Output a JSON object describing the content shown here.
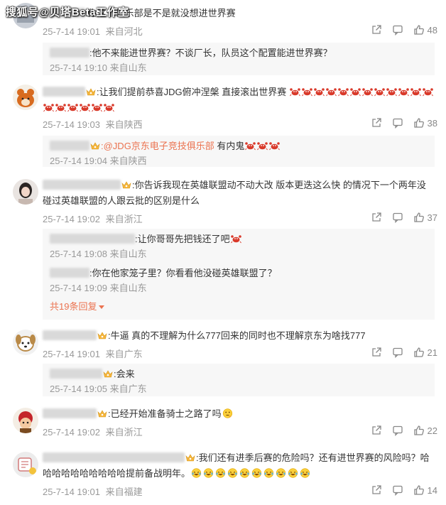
{
  "watermark": "搜狐号@贝塔Beta工作室",
  "comments": [
    {
      "text": ":你这个俱乐部是不是就没想进世界赛",
      "time": "25-7-14 19:01",
      "location": "来自河北",
      "likes": "48",
      "replies": [
        {
          "text": ":他不来能进世界赛？不谈厂长，队员这个配置能进世界赛？",
          "time": "25-7-14 19:10",
          "location": "来自山东"
        }
      ]
    },
    {
      "text": ":让我们提前恭喜JDG俯冲涅槃 直接滚出世界赛",
      "time": "25-7-14 19:03",
      "location": "来自陕西",
      "likes": "38",
      "replies": [
        {
          "at": ":@JDG京东电子竞技俱乐部",
          "text": " 有内鬼",
          "time": "25-7-14 19:04",
          "location": "来自陕西"
        }
      ]
    },
    {
      "text": ":你告诉我现在英雄联盟动不动大改 版本更迭这么快 的情况下一个两年没碰过英雄联盟的人跟云批的区别是什么",
      "time": "25-7-14 19:02",
      "location": "来自浙江",
      "likes": "37",
      "replies": [
        {
          "text": ":让你哥哥先把钱还了吧",
          "time": "25-7-14 19:08",
          "location": "来自山东"
        },
        {
          "text": ":你在他家笼子里？你看看他没碰英雄联盟了？",
          "time": "25-7-14 19:09",
          "location": "来自山东"
        }
      ],
      "more": "共19条回复"
    },
    {
      "text": ":牛逼 真的不理解为什么777回来的同时也不理解京东为啥找777",
      "time": "25-7-14 19:01",
      "location": "来自广东",
      "likes": "21",
      "replies": [
        {
          "text": ":会来",
          "time": "25-7-14 19:05",
          "location": "来自广东"
        }
      ]
    },
    {
      "text": ":已经开始准备骑士之路了吗",
      "time": "25-7-14 19:02",
      "location": "来自浙江",
      "likes": "22",
      "replies": []
    },
    {
      "text": ":我们还有进季后赛的危险吗？还有进世界赛的风险吗？哈哈哈哈哈哈哈哈哈哈提前备战明年。",
      "time": "25-7-14 19:01",
      "location": "来自福建",
      "likes": "14",
      "replies": []
    }
  ],
  "icons": {
    "share": "share-icon",
    "comment": "comment-icon",
    "like": "thumbs-up-icon"
  },
  "colors": {
    "accent": "#eb7350",
    "meta": "#999999",
    "reply_bg": "#f7f7f7"
  }
}
